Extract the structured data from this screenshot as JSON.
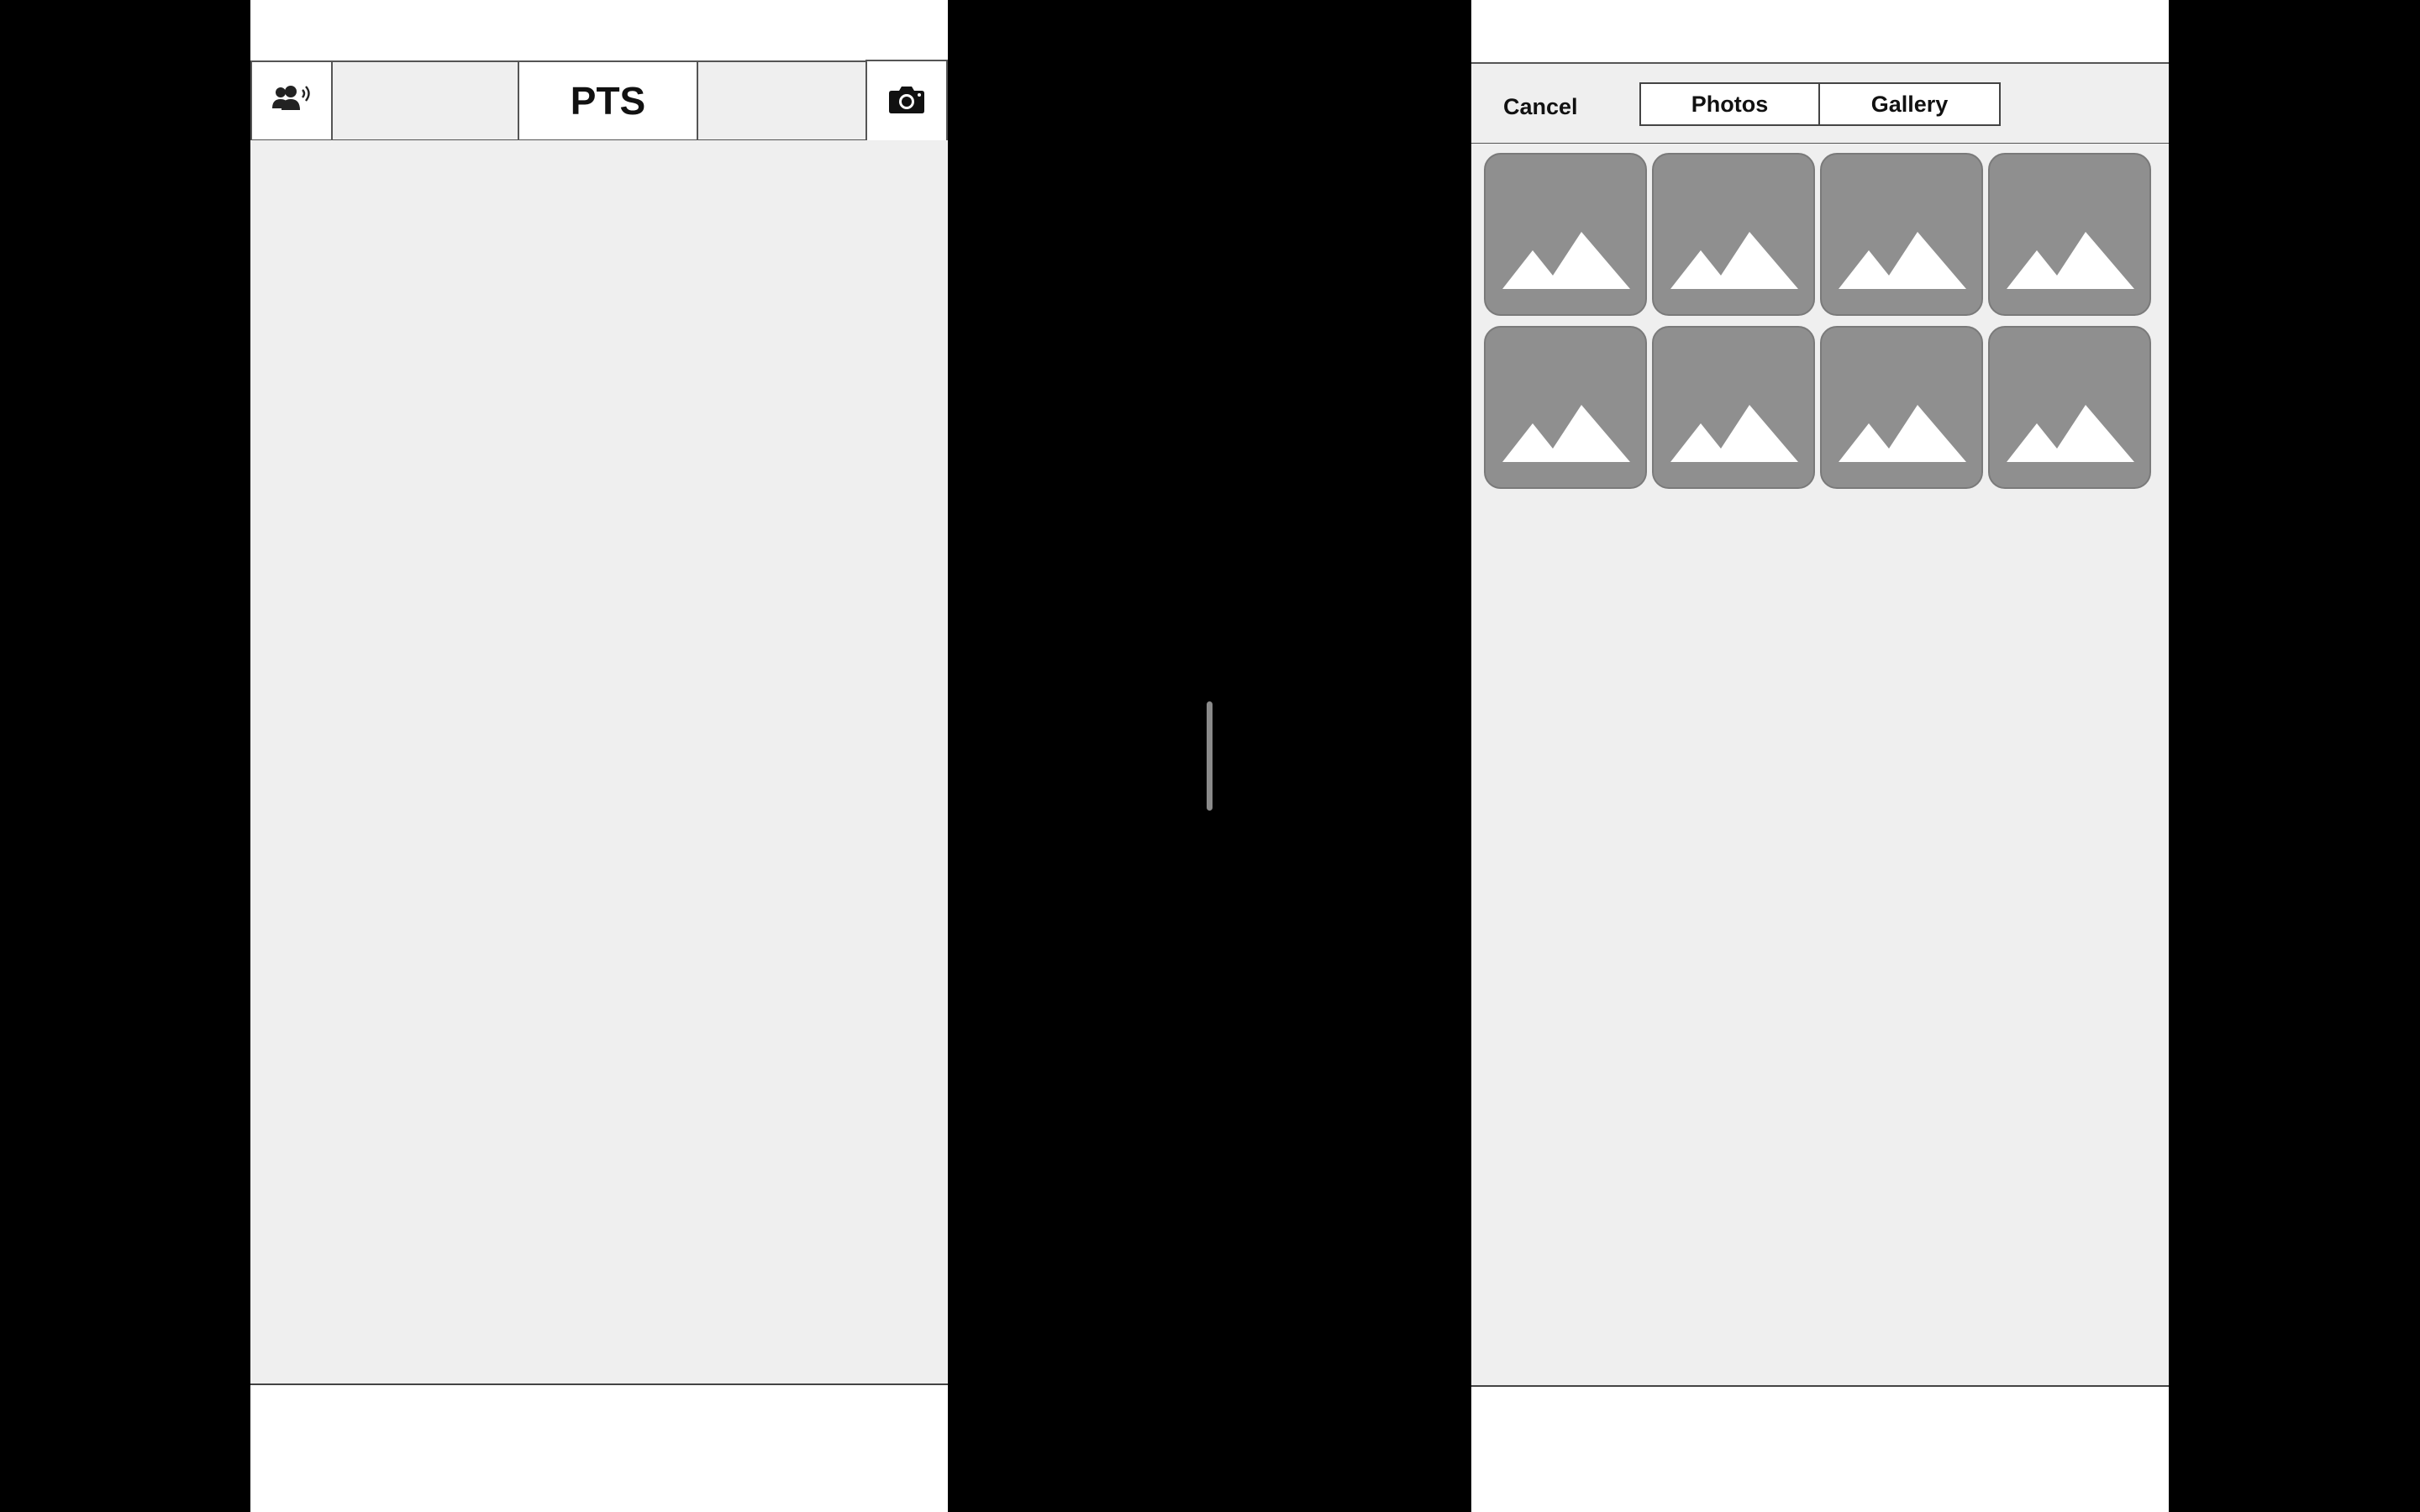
{
  "left_screen": {
    "nav": {
      "title": "PTS",
      "left_icon": "people-broadcast-icon",
      "right_icon": "camera-icon"
    }
  },
  "right_screen": {
    "header": {
      "cancel_label": "Cancel",
      "segments": [
        "Photos",
        "Gallery"
      ]
    },
    "photo_grid": {
      "columns": 4,
      "rows": 2,
      "thumbnail_icon": "image-placeholder-icon",
      "thumbnails": [
        "image-placeholder-icon",
        "image-placeholder-icon",
        "image-placeholder-icon",
        "image-placeholder-icon",
        "image-placeholder-icon",
        "image-placeholder-icon",
        "image-placeholder-icon",
        "image-placeholder-icon"
      ]
    }
  },
  "colors": {
    "background": "#000000",
    "screen": "#ffffff",
    "content": "#efefef",
    "thumbnail": "#8f8f8f",
    "divider_handle": "#8a8a8a"
  }
}
